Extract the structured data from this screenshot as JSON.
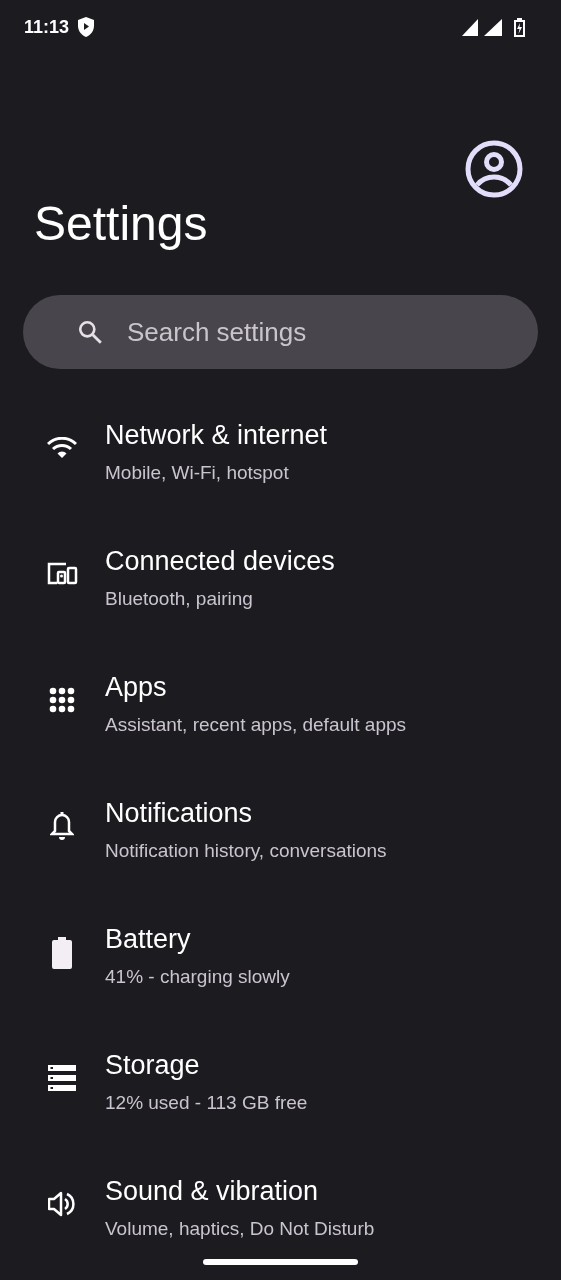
{
  "status_bar": {
    "time": "11:13"
  },
  "title": "Settings",
  "search": {
    "placeholder": "Search settings"
  },
  "items": [
    {
      "kind": "wifi",
      "title": "Network & internet",
      "subtitle": "Mobile, Wi-Fi, hotspot"
    },
    {
      "kind": "devices",
      "title": "Connected devices",
      "subtitle": "Bluetooth, pairing"
    },
    {
      "kind": "apps",
      "title": "Apps",
      "subtitle": "Assistant, recent apps, default apps"
    },
    {
      "kind": "bell",
      "title": "Notifications",
      "subtitle": "Notification history, conversations"
    },
    {
      "kind": "battery",
      "title": "Battery",
      "subtitle": "41% - charging slowly"
    },
    {
      "kind": "storage",
      "title": "Storage",
      "subtitle": "12% used - 113 GB free"
    },
    {
      "kind": "sound",
      "title": "Sound & vibration",
      "subtitle": "Volume, haptics, Do Not Disturb"
    }
  ]
}
